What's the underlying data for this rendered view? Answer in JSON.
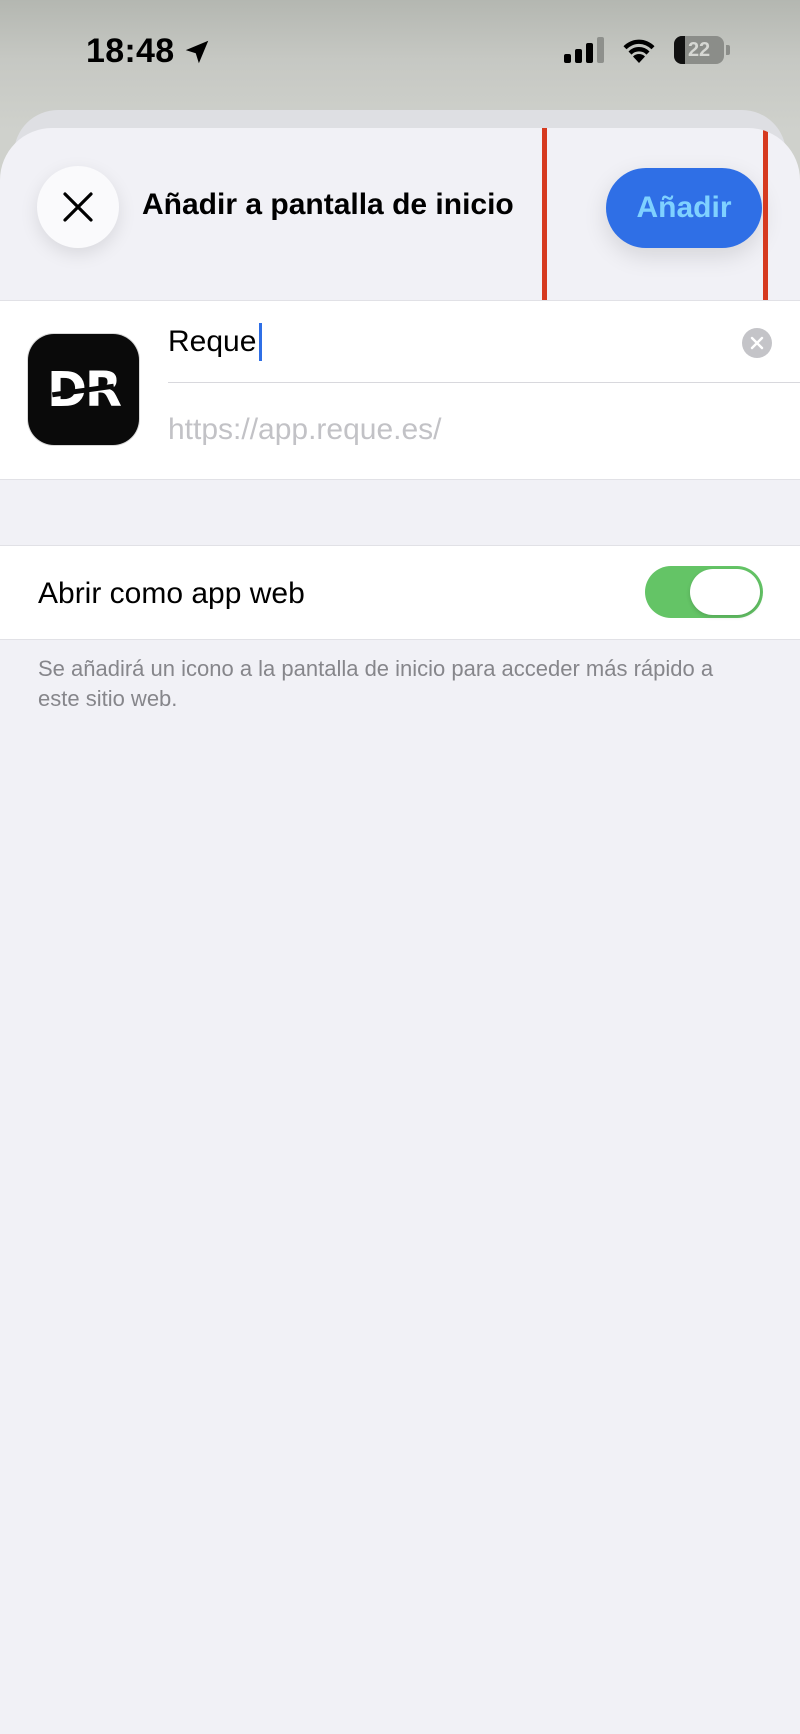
{
  "status_bar": {
    "time": "18:48",
    "location_icon": "location-arrow-icon",
    "signal_icon": "cellular-signal-icon",
    "wifi_icon": "wifi-icon",
    "battery_level": "22",
    "battery_fraction": 0.22
  },
  "header": {
    "close_icon": "close-icon",
    "title": "Añadir a pantalla de inicio",
    "add_label": "Añadir",
    "add_button_color": "#2f6fe6",
    "highlight_color": "#d63a1f"
  },
  "bookmark": {
    "icon_text": "DR",
    "name_value": "Reque",
    "url": "https://app.reque.es/",
    "clear_icon": "clear-text-icon"
  },
  "options": {
    "open_as_web_app_label": "Abrir como app web",
    "open_as_web_app_on": true,
    "toggle_color": "#64c466",
    "footer_note": "Se añadirá un icono a la pantalla de inicio para acceder más rápido a este sitio web."
  }
}
